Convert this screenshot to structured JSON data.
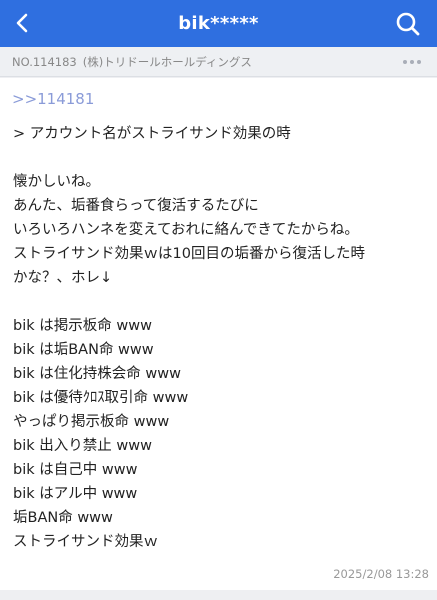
{
  "header": {
    "title": "bik*****",
    "back_icon": "chevron-left-icon",
    "search_icon": "search-icon",
    "bg_color": "#2f6fe0"
  },
  "subbar": {
    "post_number": "NO.114183",
    "company": "(株)トリドールホールディングス",
    "more_icon": "more-horizontal-icon"
  },
  "post": {
    "reply_link": ">>114181",
    "lines": [
      "> アカウント名がストライサンド効果の時",
      "",
      "懐かしいね。",
      "あんた、垢番食らって復活するたびに",
      "いろいろハンネを変えておれに絡んできてたからね。",
      "ストライサンド効果ｗは10回目の垢番から復活した時",
      "かな？、ホレ↓",
      "",
      "bik は掲示板命 www",
      "bik は垢BAN命 www",
      "bik は住化持株会命 www",
      "bik は優待ｸﾛｽ取引命 www",
      "やっぱり掲示板命 www",
      "bik 出入り禁止 www",
      "bik は自己中 www",
      "bik はアル中 www",
      "垢BAN命 www",
      "ストライサンド効果ｗ"
    ],
    "timestamp": "2025/2/08 13:28"
  }
}
